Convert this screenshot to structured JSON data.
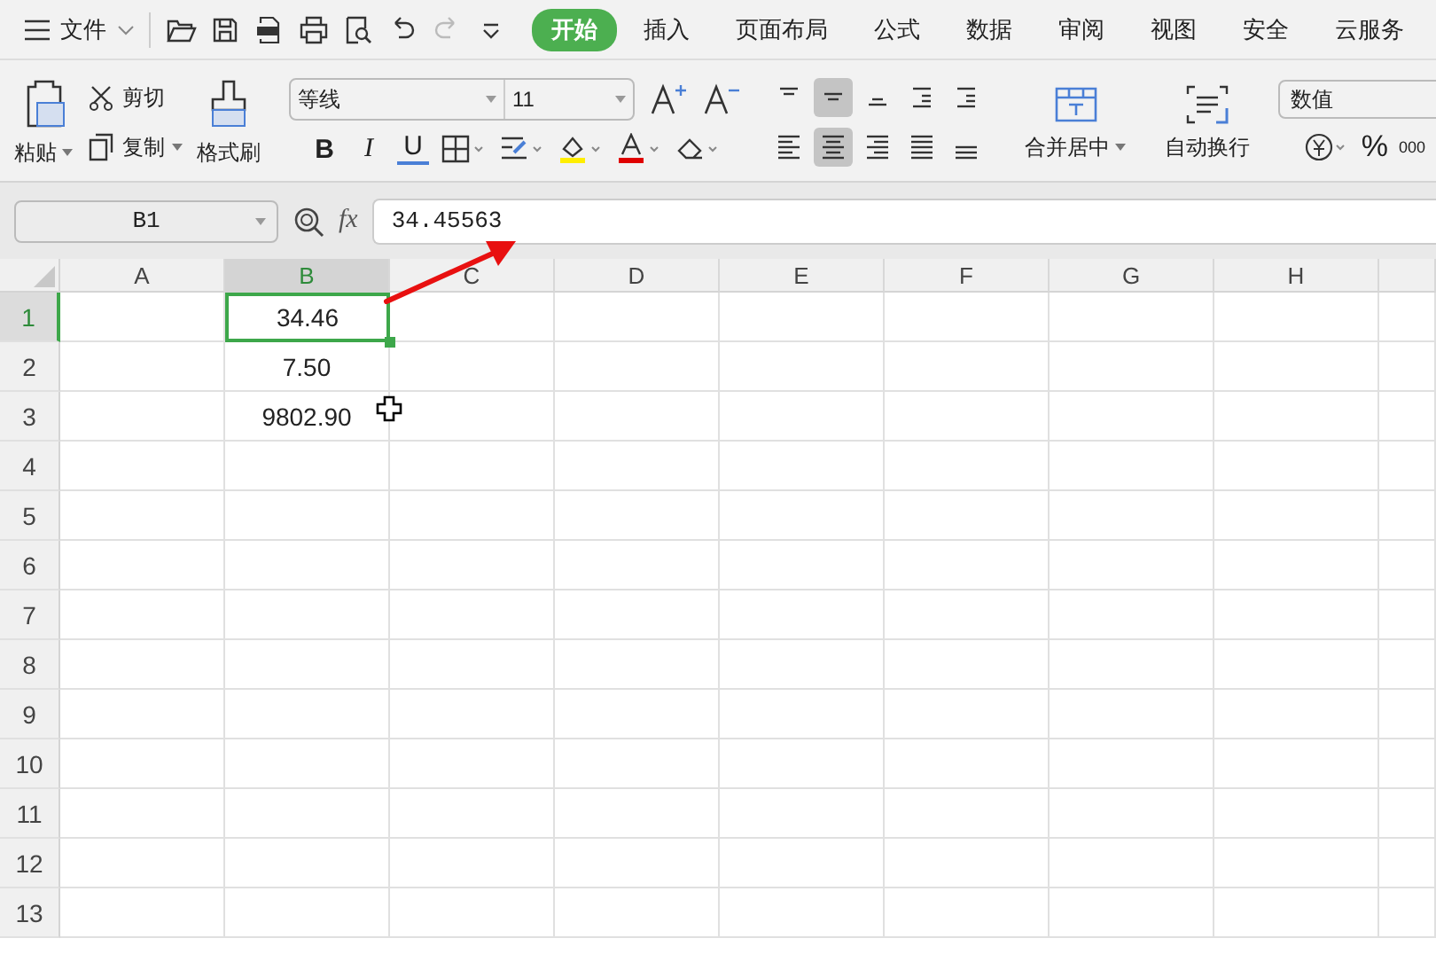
{
  "menu": {
    "label": "文件"
  },
  "tabs": [
    {
      "label": "开始",
      "selected": true
    },
    {
      "label": "插入",
      "selected": false
    },
    {
      "label": "页面布局",
      "selected": false
    },
    {
      "label": "公式",
      "selected": false
    },
    {
      "label": "数据",
      "selected": false
    },
    {
      "label": "审阅",
      "selected": false
    },
    {
      "label": "视图",
      "selected": false
    },
    {
      "label": "安全",
      "selected": false
    },
    {
      "label": "云服务",
      "selected": false
    }
  ],
  "clipboard": {
    "paste": "粘贴",
    "cut": "剪切",
    "copy": "复制",
    "painter": "格式刷"
  },
  "font": {
    "name": "等线",
    "size": "11",
    "bold": "B",
    "italic": "I",
    "underline": "U"
  },
  "alignment": {
    "vertical": [
      {
        "kind": "top",
        "selected": false
      },
      {
        "kind": "middle",
        "selected": true
      },
      {
        "kind": "bottom",
        "selected": false
      },
      {
        "kind": "outdent",
        "selected": false
      },
      {
        "kind": "indent",
        "selected": false
      }
    ],
    "horizontal": [
      {
        "kind": "left",
        "selected": false
      },
      {
        "kind": "center",
        "selected": true
      },
      {
        "kind": "right",
        "selected": false
      },
      {
        "kind": "justify",
        "selected": false
      },
      {
        "kind": "distributed",
        "selected": false
      }
    ],
    "merge": "合并居中",
    "wrap": "自动换行"
  },
  "number": {
    "format": "数值",
    "percent": "%",
    "thousands": "000"
  },
  "formula_bar": {
    "name_box": "B1",
    "fx": "fx",
    "value": "34.45563"
  },
  "columns": [
    {
      "label": "A",
      "selected": false
    },
    {
      "label": "B",
      "selected": true
    },
    {
      "label": "C",
      "selected": false
    },
    {
      "label": "D",
      "selected": false
    },
    {
      "label": "E",
      "selected": false
    },
    {
      "label": "F",
      "selected": false
    },
    {
      "label": "G",
      "selected": false
    },
    {
      "label": "H",
      "selected": false
    }
  ],
  "rows": [
    {
      "header": "1",
      "selected": true,
      "B": "34.46"
    },
    {
      "header": "2",
      "selected": false,
      "B": "7.50"
    },
    {
      "header": "3",
      "selected": false,
      "B": "9802.90"
    },
    {
      "header": "4",
      "selected": false
    },
    {
      "header": "5",
      "selected": false
    },
    {
      "header": "6",
      "selected": false
    },
    {
      "header": "7",
      "selected": false
    },
    {
      "header": "8",
      "selected": false
    },
    {
      "header": "9",
      "selected": false
    },
    {
      "header": "10",
      "selected": false
    },
    {
      "header": "11",
      "selected": false
    },
    {
      "header": "12",
      "selected": false
    },
    {
      "header": "13",
      "selected": false
    }
  ]
}
